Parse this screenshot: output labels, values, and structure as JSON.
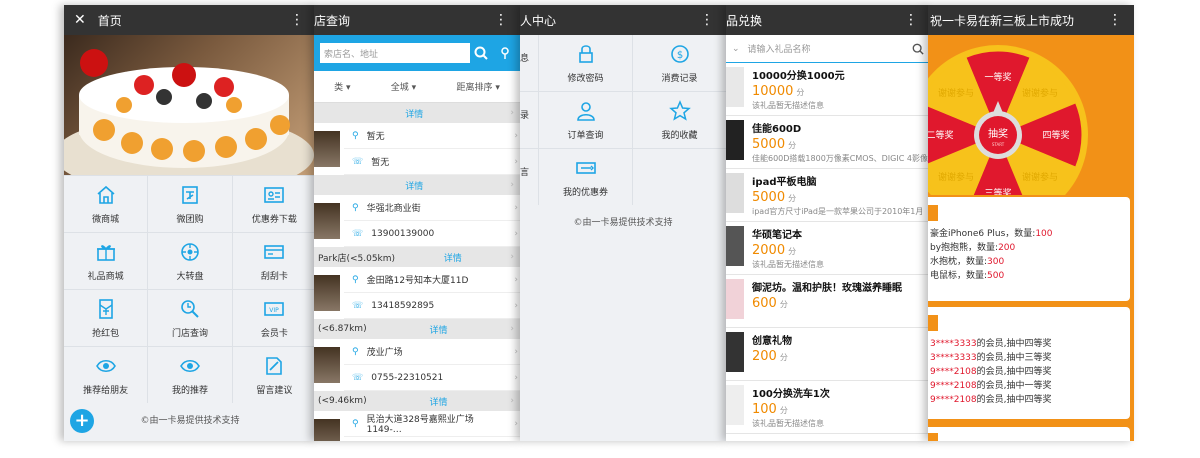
{
  "colors": {
    "accent": "#1ea5e4",
    "orange": "#f29117",
    "red": "#e0182d"
  },
  "p1": {
    "title": "首页",
    "menu": [
      "微商城",
      "微团购",
      "优惠券下载",
      "礼品商城",
      "大转盘",
      "刮刮卡",
      "抢红包",
      "门店查询",
      "会员卡",
      "推荐给朋友",
      "我的推荐",
      "留言建议"
    ],
    "credit": "©由一卡易提供技术支持"
  },
  "p2": {
    "title": "店查询",
    "placeholder": "索店名、地址",
    "filters": [
      "类",
      "全城",
      "距离排序"
    ],
    "detail": "详情",
    "stores": [
      {
        "name": "",
        "addr": "暂无",
        "phone": "暂无"
      },
      {
        "name": "",
        "addr": "华强北商业街",
        "phone": "13900139000"
      },
      {
        "name": "Park店(<5.05km)",
        "addr": "金田路12号知本大厦11D",
        "phone": "13418592895"
      },
      {
        "name": "(<6.87km)",
        "addr": "茂业广场",
        "phone": "0755-22310521"
      },
      {
        "name": "(<9.46km)",
        "addr": "民治大道328号嘉熙业广场1149-…",
        "phone": ""
      }
    ]
  },
  "p3": {
    "title": "人中心",
    "items": [
      [
        "息",
        "修改密码",
        "消费记录"
      ],
      [
        "录",
        "订单查询",
        "我的收藏"
      ],
      [
        "言",
        "我的优惠券",
        ""
      ]
    ],
    "credit": "©由一卡易提供技术支持"
  },
  "p4": {
    "title": "品兑换",
    "placeholder": "请输入礼品名称",
    "unit": "分",
    "items": [
      {
        "title": "10000分换1000元",
        "pts": "10000",
        "desc": "该礼品暂无描述信息"
      },
      {
        "title": "佳能600D",
        "pts": "5000",
        "desc": "佳能600D搭载1800万像素CMOS、DIGIC 4影像"
      },
      {
        "title": "ipad平板电脑",
        "pts": "5000",
        "desc": "ipad官方尺寸iPad是一款苹果公司于2010年1月"
      },
      {
        "title": "华硕笔记本",
        "pts": "2000",
        "desc": "该礼品暂无描述信息"
      },
      {
        "title": "御泥坊。温和护肤！玫瑰滋养睡眠",
        "pts": "600",
        "desc": ""
      },
      {
        "title": "创意礼物",
        "pts": "200",
        "desc": ""
      },
      {
        "title": "100分换洗车1次",
        "pts": "100",
        "desc": "该礼品暂无描述信息"
      }
    ]
  },
  "p5": {
    "title": "祝一卡易在新三板上市成功",
    "wheel": {
      "center": "抽奖",
      "start": "START",
      "prizes": [
        "一等奖",
        "四等奖",
        "三等奖",
        "二等奖"
      ],
      "faded": [
        "谢谢参与",
        "谢谢参与",
        "谢谢参与",
        "谢谢参与"
      ]
    },
    "prize_list": [
      {
        "a": "豪金iPhone6 Plus，数量:",
        "b": "100"
      },
      {
        "a": "by抱抱熊，数量:",
        "b": "200"
      },
      {
        "a": "水抱枕，数量:",
        "b": "300"
      },
      {
        "a": "电鼠标，数量:",
        "b": "500"
      }
    ],
    "winners": [
      {
        "a": "3****3333",
        "b": "的会员,抽中四等奖"
      },
      {
        "a": "3****3333",
        "b": "的会员,抽中三等奖"
      },
      {
        "a": "9****2108",
        "b": "的会员,抽中四等奖"
      },
      {
        "a": "9****2108",
        "b": "的会员,抽中一等奖"
      },
      {
        "a": "9****2108",
        "b": "的会员,抽中四等奖"
      }
    ]
  }
}
